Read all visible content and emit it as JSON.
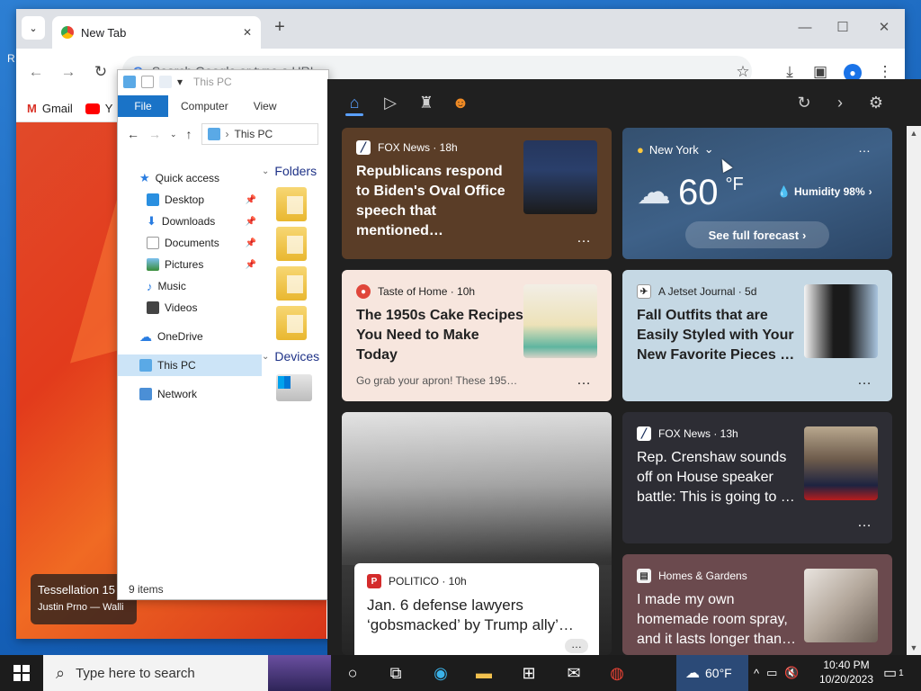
{
  "desktop": {
    "label": "R"
  },
  "chrome": {
    "tab_title": "New Tab",
    "tab_close": "✕",
    "new_tab": "+",
    "omnibox_placeholder": "Search Google or type a URL",
    "bookmarks": [
      "Gmail",
      "Y"
    ],
    "window": {
      "min": "—",
      "max": "☐",
      "close": "✕"
    }
  },
  "wallpaper_credit": {
    "title": "Tessellation 15",
    "author": "Justin Prno — Walli"
  },
  "explorer": {
    "title": "This PC",
    "ribbon": {
      "file": "File",
      "computer": "Computer",
      "view": "View"
    },
    "address": "This PC",
    "nav": [
      {
        "label": "Quick access"
      },
      {
        "label": "Desktop"
      },
      {
        "label": "Downloads"
      },
      {
        "label": "Documents"
      },
      {
        "label": "Pictures"
      },
      {
        "label": "Music"
      },
      {
        "label": "Videos"
      },
      {
        "label": "OneDrive"
      },
      {
        "label": "This PC"
      },
      {
        "label": "Network"
      }
    ],
    "groups": {
      "folders": "Folders",
      "devices": "Devices"
    },
    "status": "9 items"
  },
  "news": {
    "cards": [
      {
        "source": "FOX News · 18h",
        "title": "Republicans respond to Biden's Oval Office speech that mentioned…"
      },
      {
        "source": "Taste of Home · 10h",
        "title": "The 1950s Cake Recipes You Need to Make Today",
        "snippet": "Go grab your apron! These 195…"
      },
      {
        "source": "A Jetset Journal · 5d",
        "title": "Fall Outfits that are Easily Styled with Your New Favorite Pieces …"
      },
      {
        "source": "FOX News · 13h",
        "title": "Rep. Crenshaw sounds off on House speaker battle: This is going to …"
      },
      {
        "source": "POLITICO · 10h",
        "title": "Jan. 6 defense lawyers ‘gobsmacked’ by Trump ally’…"
      },
      {
        "source": "Homes & Gardens",
        "title": "I made my own homemade room spray, and it lasts longer than…"
      }
    ],
    "weather": {
      "location": "New York",
      "temp": "60",
      "unit": "°F",
      "humidity": "Humidity 98%",
      "forecast_button": "See full forecast"
    },
    "more": "…"
  },
  "taskbar": {
    "search_placeholder": "Type here to search",
    "weather_temp": "60°F",
    "time": "10:40 PM",
    "date": "10/20/2023",
    "notification_count": "1"
  },
  "colors": {
    "accent": "#1a73c7",
    "news_bg": "#202020",
    "taskbar": "#1c1c1c"
  }
}
